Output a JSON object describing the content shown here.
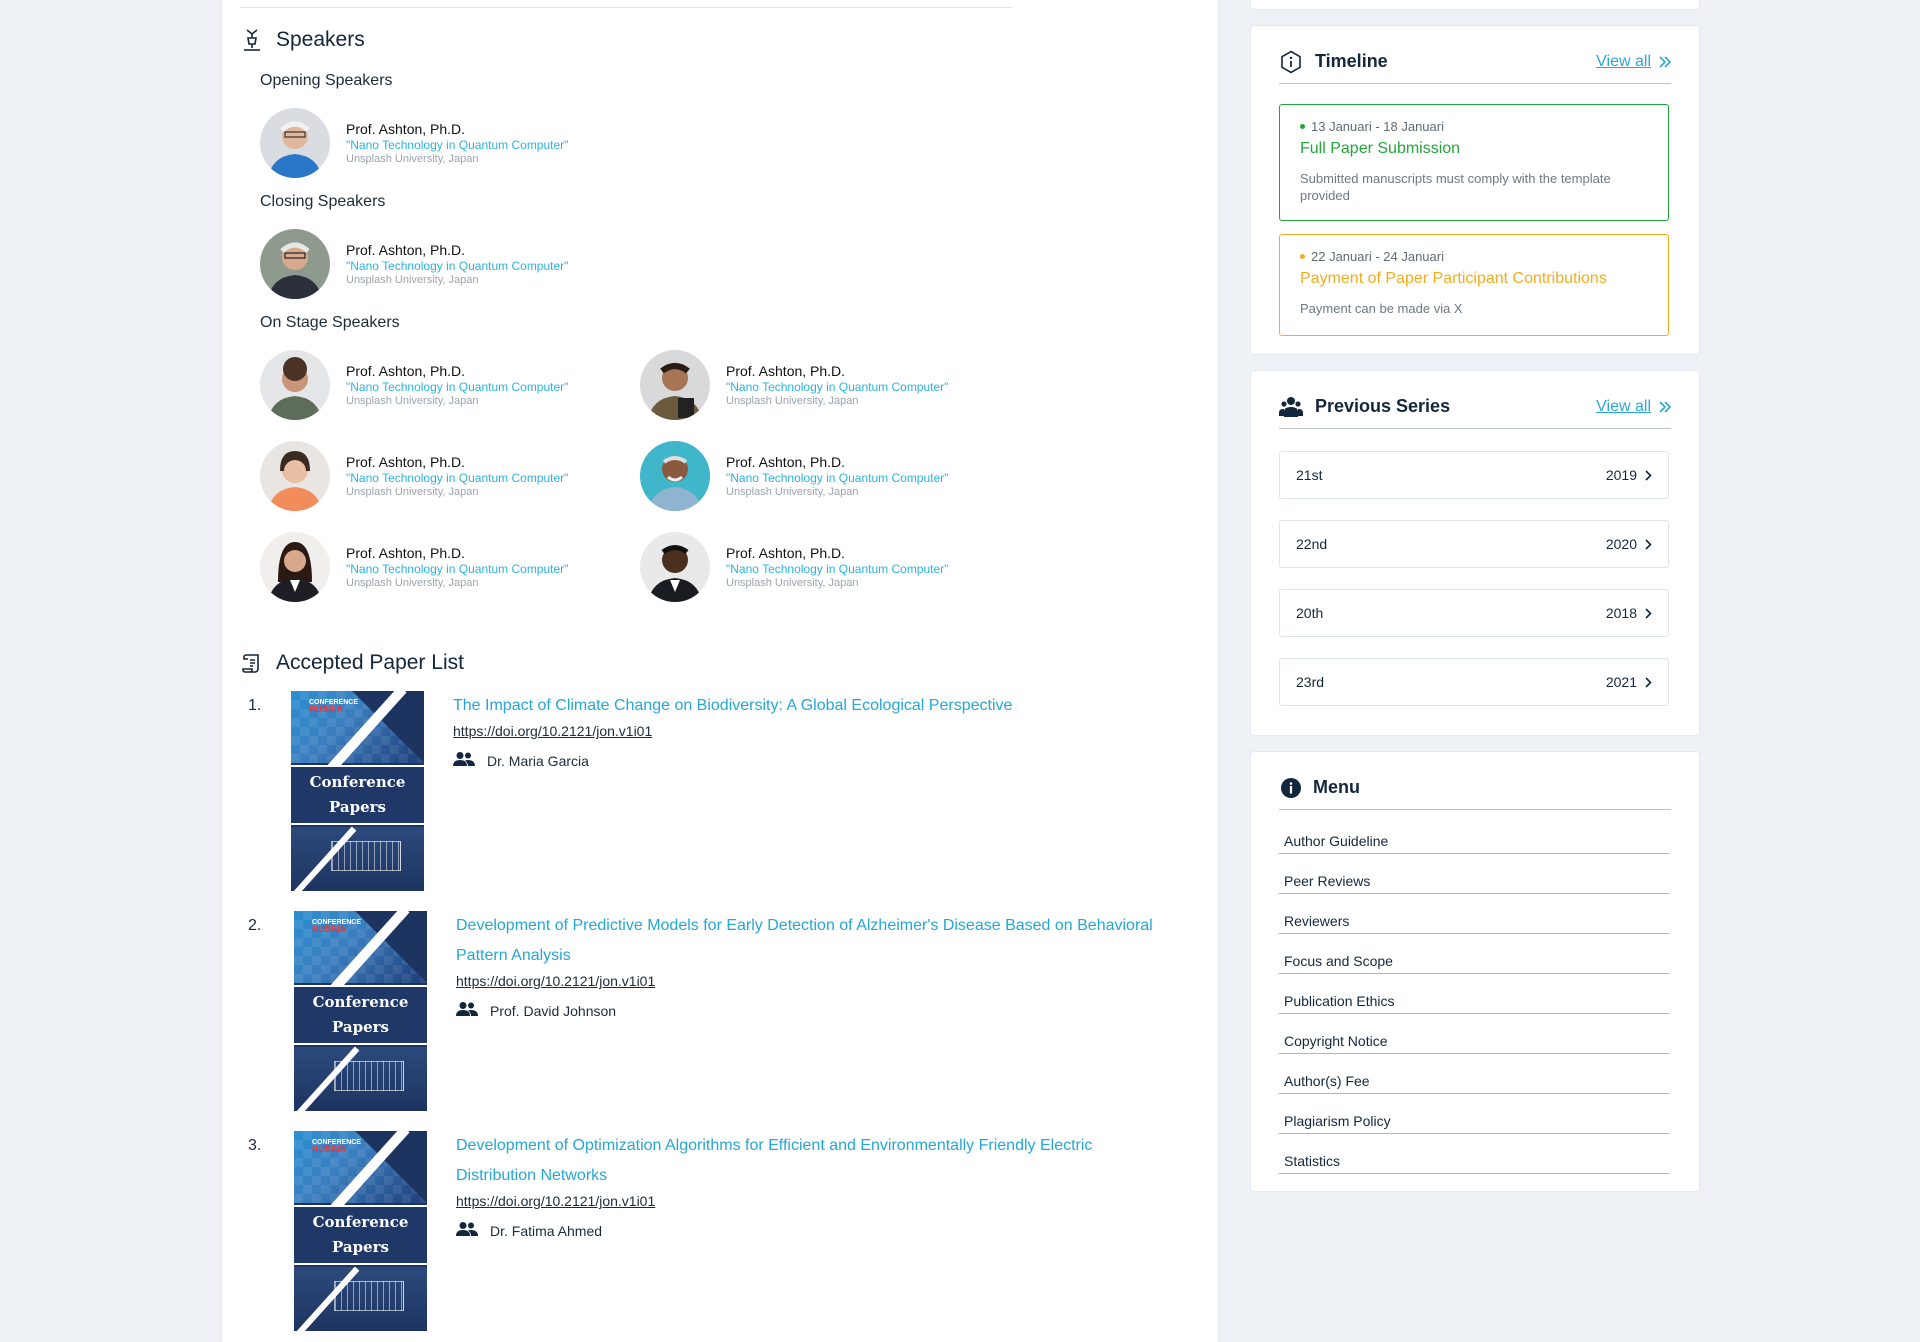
{
  "speakers_section": {
    "title": "Speakers",
    "groups": [
      {
        "label": "Opening Speakers",
        "speakers": [
          {
            "name": "Prof. Ashton, Ph.D.",
            "topic": "\"Nano Technology in Quantum Computer\"",
            "affiliation": "Unsplash University, Japan"
          }
        ]
      },
      {
        "label": "Closing Speakers",
        "speakers": [
          {
            "name": "Prof. Ashton, Ph.D.",
            "topic": "\"Nano Technology in Quantum Computer\"",
            "affiliation": "Unsplash University, Japan"
          }
        ]
      },
      {
        "label": "On Stage Speakers",
        "speakers": [
          {
            "name": "Prof. Ashton, Ph.D.",
            "topic": "\"Nano Technology in Quantum Computer\"",
            "affiliation": "Unsplash University, Japan"
          },
          {
            "name": "Prof. Ashton, Ph.D.",
            "topic": "\"Nano Technology in Quantum Computer\"",
            "affiliation": "Unsplash University, Japan"
          },
          {
            "name": "Prof. Ashton, Ph.D.",
            "topic": "\"Nano Technology in Quantum Computer\"",
            "affiliation": "Unsplash University, Japan"
          },
          {
            "name": "Prof. Ashton, Ph.D.",
            "topic": "\"Nano Technology in Quantum Computer\"",
            "affiliation": "Unsplash University, Japan"
          },
          {
            "name": "Prof. Ashton, Ph.D.",
            "topic": "\"Nano Technology in Quantum Computer\"",
            "affiliation": "Unsplash University, Japan"
          },
          {
            "name": "Prof. Ashton, Ph.D.",
            "topic": "\"Nano Technology in Quantum Computer\"",
            "affiliation": "Unsplash University, Japan"
          }
        ]
      }
    ]
  },
  "papers_section": {
    "title": "Accepted Paper List",
    "cover": {
      "logo_line1": "CONFERENCE",
      "logo_line2": "RUSSIA",
      "band_line1": "Conference",
      "band_line2": "Papers"
    },
    "papers": [
      {
        "number": "1.",
        "title": "The Impact of Climate Change on Biodiversity: A Global Ecological Perspective",
        "doi": "https://doi.org/10.2121/jon.v1i01",
        "author": "Dr. Maria Garcia"
      },
      {
        "number": "2.",
        "title": "Development of Predictive Models for Early Detection of Alzheimer's Disease Based on Behavioral Pattern Analysis",
        "doi": "https://doi.org/10.2121/jon.v1i01",
        "author": "Prof. David Johnson"
      },
      {
        "number": "3.",
        "title": "Development of Optimization Algorithms for Efficient and Environmentally Friendly Electric Distribution Networks",
        "doi": "https://doi.org/10.2121/jon.v1i01",
        "author": "Dr. Fatima Ahmed"
      }
    ]
  },
  "timeline": {
    "title": "Timeline",
    "view_all": "View all",
    "items": [
      {
        "date": "13 Januari - 18 Januari",
        "title": "Full Paper Submission",
        "description": "Submitted manuscripts must comply with the template provided",
        "color": "#22a63a"
      },
      {
        "date": "22 Januari - 24 Januari",
        "title": "Payment of Paper Participant Contributions",
        "description": "Payment can be made via X",
        "color": "#f2ad1f"
      }
    ]
  },
  "previous_series": {
    "title": "Previous Series",
    "view_all": "View all",
    "items": [
      {
        "label": "21st",
        "year": "2019"
      },
      {
        "label": "22nd",
        "year": "2020"
      },
      {
        "label": "20th",
        "year": "2018"
      },
      {
        "label": "23rd",
        "year": "2021"
      }
    ]
  },
  "menu": {
    "title": "Menu",
    "items": [
      "Author Guideline",
      "Peer Reviews",
      "Reviewers",
      "Focus and Scope",
      "Publication Ethics",
      "Copyright Notice",
      "Author(s) Fee",
      "Plagiarism Policy",
      "Statistics"
    ]
  },
  "colors": {
    "accent": "#2aa7d8",
    "dark": "#13273c"
  }
}
